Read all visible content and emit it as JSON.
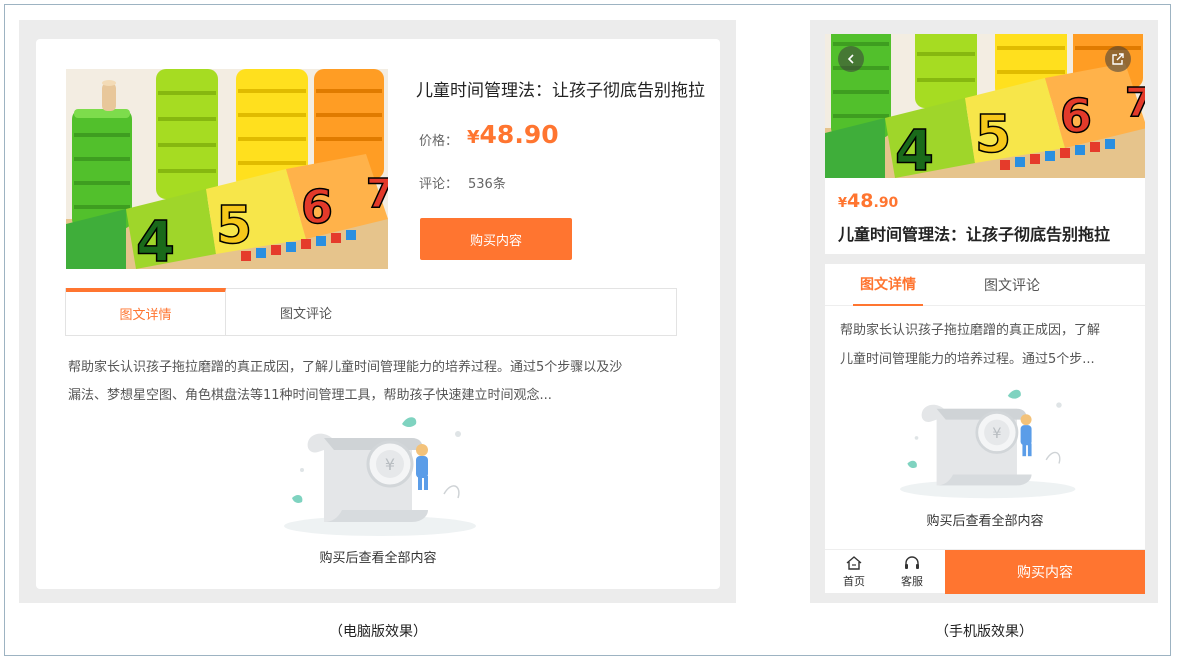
{
  "product": {
    "title": "儿童时间管理法：让孩子彻底告别拖拉",
    "price_currency": "¥",
    "price": "48.90",
    "price_int": "48",
    "price_dec": ".90",
    "price_label": "价格：",
    "comment_label": "评论：",
    "comment_count": "536条",
    "buy_label": "购买内容"
  },
  "tabs": [
    {
      "label": "图文详情",
      "active": true
    },
    {
      "label": "图文评论",
      "active": false
    }
  ],
  "pc": {
    "description_line1": "帮助家长认识孩子拖拉磨蹭的真正成因，了解儿童时间管理能力的培养过程。通过5个步骤以及沙",
    "description_line2": "漏法、梦想星空图、角色棋盘法等11种时间管理工具，帮助孩子快速建立时间观念...",
    "locked_text": "购买后查看全部内容",
    "caption": "（电脑版效果）"
  },
  "mobile": {
    "description_line1": "帮助家长认识孩子拖拉磨蹭的真正成因，了解",
    "description_line2": "儿童时间管理能力的培养过程。通过5个步...",
    "locked_text": "购买后查看全部内容",
    "nav_home": "首页",
    "nav_service": "客服",
    "caption": "（手机版效果）"
  },
  "image": {
    "numbers": [
      "4",
      "5",
      "6",
      "7"
    ]
  },
  "icons": {
    "back": "chevron-left-icon",
    "share": "share-icon",
    "home": "home-icon",
    "service": "headset-icon",
    "illustration": "locked-scroll-illustration"
  },
  "colors": {
    "accent": "#ff7530",
    "panel_bg": "#ececec"
  }
}
